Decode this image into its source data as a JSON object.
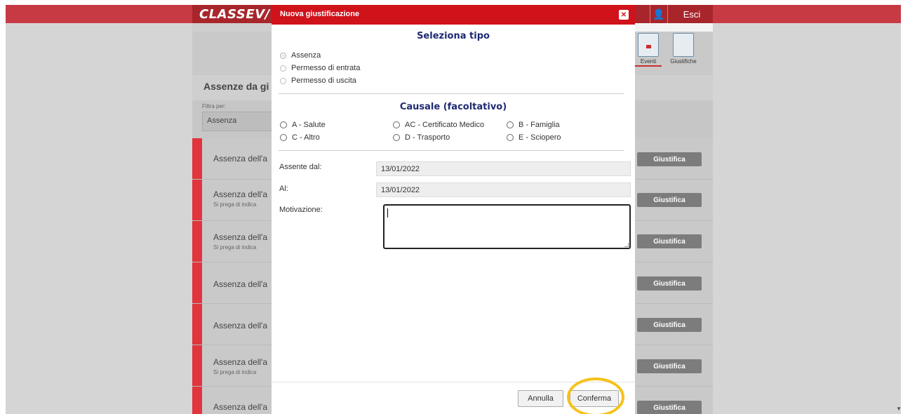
{
  "app": {
    "logo": "CLASSEV/",
    "logout_label": "Esci"
  },
  "toolbar": [
    {
      "label": "Eventi",
      "icon": "calendar-icon"
    },
    {
      "label": "Giustifiche",
      "icon": "list-icon"
    }
  ],
  "page": {
    "title": "Assenze da gi",
    "filter_label": "Filtra per:",
    "filter_value": "Assenza",
    "rows": [
      {
        "title": "Assenza dell'a",
        "subtitle": "",
        "button": "Giustifica"
      },
      {
        "title": "Assenza dell'a",
        "subtitle": "Si prega di indica",
        "button": "Giustifica"
      },
      {
        "title": "Assenza dell'a",
        "subtitle": "Si prega di indica",
        "button": "Giustifica"
      },
      {
        "title": "Assenza dell'a",
        "subtitle": "",
        "button": "Giustifica"
      },
      {
        "title": "Assenza dell'a",
        "subtitle": "",
        "button": "Giustifica"
      },
      {
        "title": "Assenza dell'a",
        "subtitle": "Si prega di indica",
        "button": "Giustifica"
      },
      {
        "title": "Assenza dell'a",
        "subtitle": "",
        "button": "Giustifica"
      }
    ]
  },
  "modal": {
    "title": "Nuova giustificazione",
    "close_icon": "close-icon",
    "tipo": {
      "heading": "Seleziona tipo",
      "options": [
        "Assenza",
        "Permesso di entrata",
        "Permesso di uscita"
      ],
      "selected": "Assenza"
    },
    "causale": {
      "heading": "Causale (facoltativo)",
      "options": [
        "A - Salute",
        "AC - Certificato Medico",
        "B - Famiglia",
        "C - Altro",
        "D - Trasporto",
        "E - Sciopero"
      ]
    },
    "form": {
      "from_label": "Assente dal:",
      "from_value": "13/01/2022",
      "to_label": "Al:",
      "to_value": "13/01/2022",
      "reason_label": "Motivazione:",
      "reason_value": ""
    },
    "cancel_label": "Annulla",
    "confirm_label": "Conferma"
  },
  "colors": {
    "brand_red": "#d0121b",
    "heading_blue": "#1e2a73",
    "highlight_ring": "#f5c21b"
  }
}
